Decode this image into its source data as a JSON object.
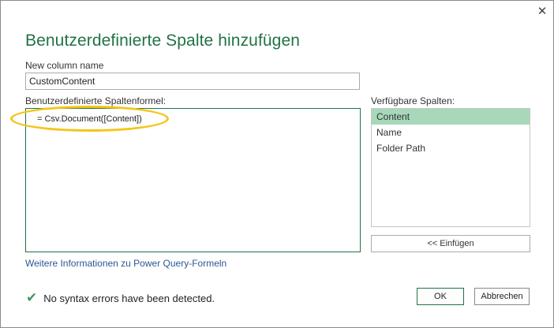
{
  "dialog": {
    "title": "Benutzerdefinierte Spalte hinzufügen",
    "close_icon": "✕"
  },
  "new_column": {
    "label": "New column name",
    "value": "CustomContent"
  },
  "formula": {
    "label": "Benutzerdefinierte Spaltenformel:",
    "value": "= Csv.Document([Content])"
  },
  "available_columns": {
    "label": "Verfügbare Spalten:",
    "items": [
      {
        "label": "Content",
        "selected": true
      },
      {
        "label": "Name",
        "selected": false
      },
      {
        "label": "Folder Path",
        "selected": false
      }
    ],
    "insert_label": "<< Einfügen"
  },
  "help_link": "Weitere Informationen zu Power Query-Formeln",
  "status": {
    "icon": "check-icon",
    "text": "No syntax errors have been detected."
  },
  "buttons": {
    "ok": "OK",
    "cancel": "Abbrechen"
  },
  "colors": {
    "accent": "#217346",
    "selection": "#a7d8b9",
    "highlight": "#f4c517",
    "link": "#2b5797"
  }
}
